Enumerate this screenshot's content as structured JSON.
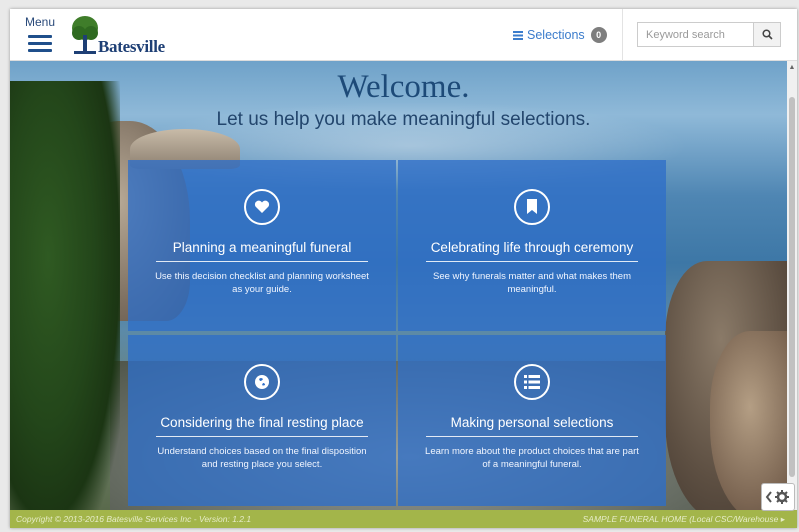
{
  "header": {
    "menu_label": "Menu",
    "logo_text": "Batesville",
    "selections_label": "Selections",
    "selections_count": "0",
    "search_placeholder": "Keyword search"
  },
  "hero": {
    "title": "Welcome.",
    "subtitle": "Let us help you make meaningful selections."
  },
  "tiles": [
    {
      "icon": "heart-icon",
      "title": "Planning a meaningful funeral",
      "description": "Use this decision checklist and planning worksheet as your guide."
    },
    {
      "icon": "bookmark-icon",
      "title": "Celebrating life through ceremony",
      "description": "See why funerals matter and what makes them meaningful."
    },
    {
      "icon": "globe-icon",
      "title": "Considering the final resting place",
      "description": "Understand choices based on the final disposition and resting place you select."
    },
    {
      "icon": "list-icon",
      "title": "Making personal selections",
      "description": "Learn more about the product choices that are part of a meaningful funeral."
    }
  ],
  "footer": {
    "copyright": "Copyright © 2013-2016 Batesville Services Inc - Version: 1.2.1",
    "location": "SAMPLE FUNERAL HOME (Local CSC/Warehouse ▸"
  },
  "colors": {
    "brand_blue": "#1e3f75",
    "tile_blue": "#2e6ec8",
    "footer_green": "#a3b54a",
    "link_blue": "#3b7ccc"
  }
}
